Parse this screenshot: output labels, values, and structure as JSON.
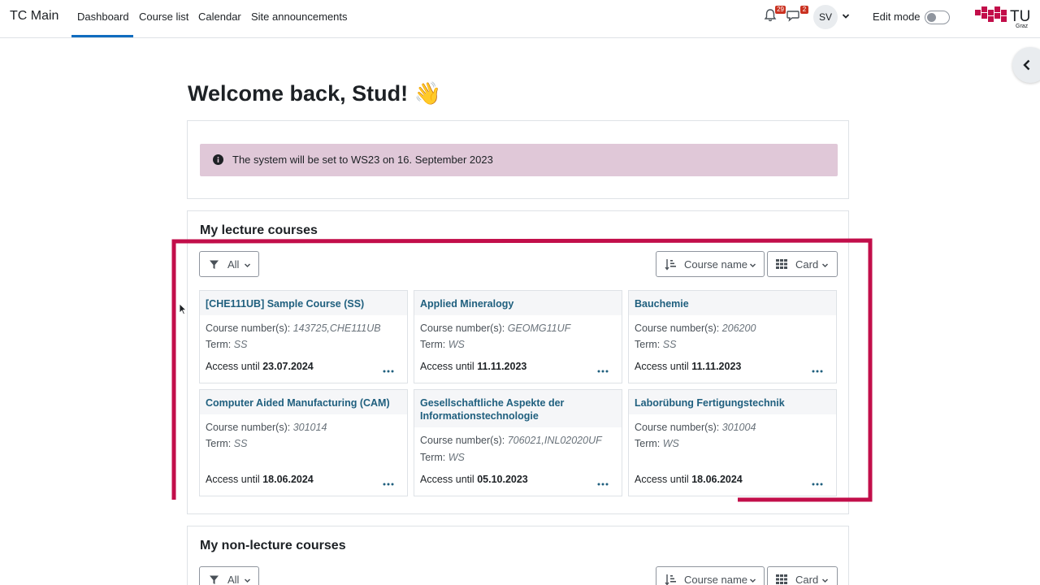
{
  "navbar": {
    "brand": "TC Main",
    "items": [
      {
        "label": "Dashboard",
        "active": true
      },
      {
        "label": "Course list"
      },
      {
        "label": "Calendar"
      },
      {
        "label": "Site announcements"
      }
    ],
    "notifications_count": "29",
    "messages_count": "2",
    "user_initials": "SV",
    "edit_mode_label": "Edit mode",
    "logo_text": "TU",
    "logo_subtext": "Graz"
  },
  "page": {
    "welcome": "Welcome back, Stud! 👋"
  },
  "alert": {
    "text": "The system will be set to WS23 on 16. September 2023"
  },
  "lecture": {
    "title": "My lecture courses",
    "filter_label": "All",
    "sort_label": "Course name",
    "view_label": "Card",
    "cards": [
      {
        "title": "[CHE111UB] Sample Course (SS)",
        "numbers": "143725,CHE111UB",
        "term": "SS",
        "access": "23.07.2024"
      },
      {
        "title": "Applied Mineralogy",
        "numbers": "GEOMG11UF",
        "term": "WS",
        "access": "11.11.2023"
      },
      {
        "title": "Bauchemie",
        "numbers": "206200",
        "term": "SS",
        "access": "11.11.2023"
      },
      {
        "title": "Computer Aided Manufacturing (CAM)",
        "numbers": "301014",
        "term": "SS",
        "access": "18.06.2024"
      },
      {
        "title": "Gesellschaftliche Aspekte der Informationstechnologie",
        "numbers": "706021,INL02020UF",
        "term": "WS",
        "access": "05.10.2023"
      },
      {
        "title": "Laborübung Fertigungstechnik",
        "numbers": "301004",
        "term": "WS",
        "access": "18.06.2024"
      }
    ]
  },
  "labels": {
    "course_numbers": "Course number(s):",
    "term": "Term:",
    "access_until": "Access until"
  },
  "nonlecture": {
    "title": "My non-lecture courses",
    "filter_label": "All",
    "sort_label": "Course name",
    "view_label": "Card"
  },
  "colors": {
    "link": "#1f5f7e",
    "alert_bg": "#e0c8d8",
    "highlight": "#c20e4a",
    "active_nav": "#0f6cbf"
  }
}
